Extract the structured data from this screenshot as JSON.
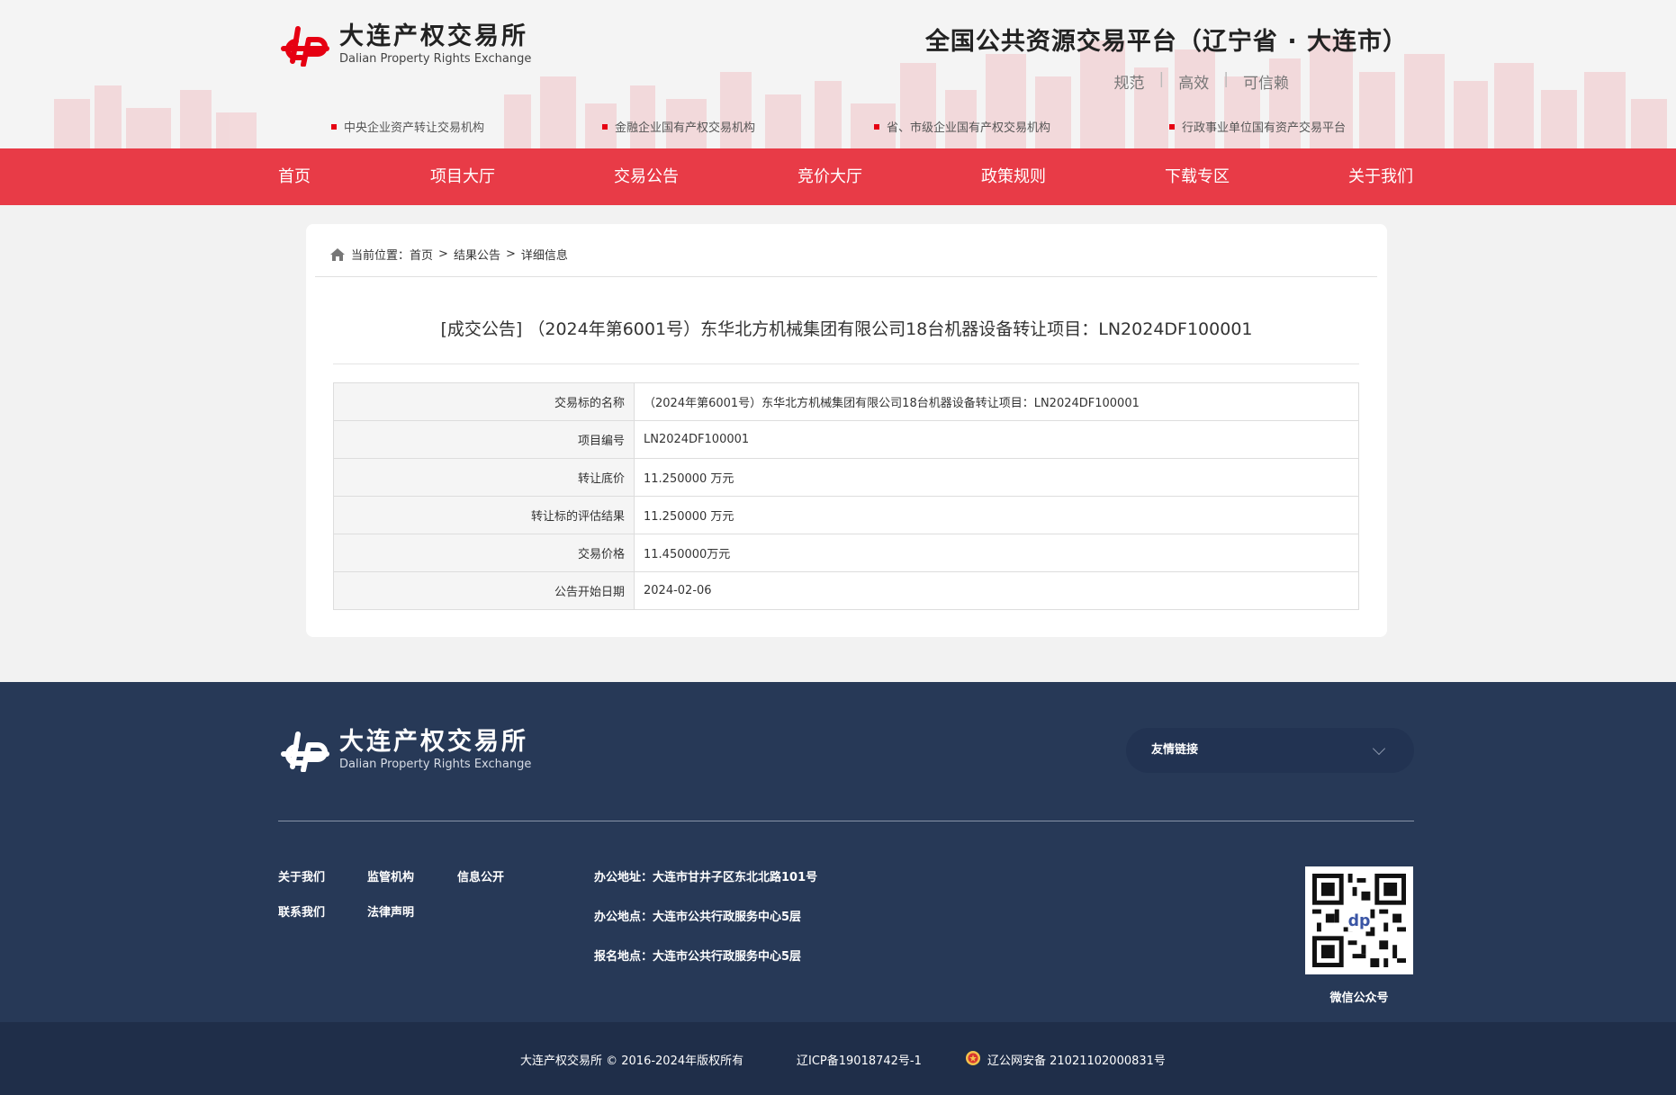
{
  "header": {
    "logo_cn": "大连产权交易所",
    "logo_en": "Dalian Property Rights Exchange",
    "platform_title": "全国公共资源交易平台（辽宁省 · 大连市）",
    "slogans": [
      "规范",
      "高效",
      "可信赖"
    ],
    "org_links": [
      "中央企业资产转让交易机构",
      "金融企业国有产权交易机构",
      "省、市级企业国有产权交易机构",
      "行政事业单位国有资产交易平台"
    ]
  },
  "nav": {
    "items": [
      "首页",
      "项目大厅",
      "交易公告",
      "竞价大厅",
      "政策规则",
      "下载专区",
      "关于我们"
    ]
  },
  "breadcrumb": {
    "prefix": "当前位置：",
    "items": [
      "首页",
      "结果公告",
      "详细信息"
    ],
    "separator": ">"
  },
  "notice": {
    "title": "[成交公告] （2024年第6001号）东华北方机械集团有限公司18台机器设备转让项目：LN2024DF100001",
    "rows": [
      {
        "key": "交易标的名称",
        "value": "（2024年第6001号）东华北方机械集团有限公司18台机器设备转让项目：LN2024DF100001"
      },
      {
        "key": "项目编号",
        "value": "LN2024DF100001"
      },
      {
        "key": "转让底价",
        "value": "11.250000 万元"
      },
      {
        "key": "转让标的评估结果",
        "value": "11.250000 万元"
      },
      {
        "key": "交易价格",
        "value": "11.450000万元"
      },
      {
        "key": "公告开始日期",
        "value": "2024-02-06"
      }
    ]
  },
  "footer": {
    "logo_cn": "大连产权交易所",
    "logo_en": "Dalian Property Rights Exchange",
    "friend_links_label": "友情链接",
    "links": [
      "关于我们",
      "监管机构",
      "信息公开",
      "联系我们",
      "法律声明"
    ],
    "info": [
      "办公地址：大连市甘井子区东北北路101号",
      "办公地点：大连市公共行政服务中心5层",
      "报名地点：大连市公共行政服务中心5层"
    ],
    "qr_caption": "微信公众号",
    "copyright": "大连产权交易所 © 2016-2024年版权所有",
    "icp": "辽ICP备19018742号-1",
    "police": "辽公网安备 21021102000831号"
  },
  "colors": {
    "brand_red": "#e60012",
    "nav_red": "#e83b47",
    "footer_navy": "#273957",
    "bottom_navy": "#1f2e49"
  }
}
